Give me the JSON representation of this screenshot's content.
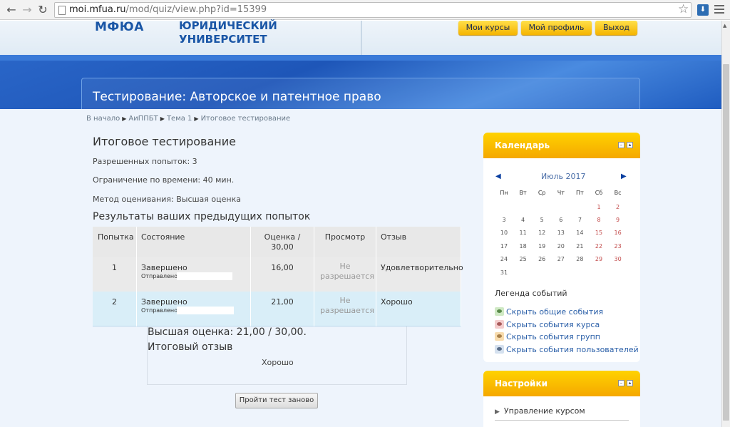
{
  "browser": {
    "url_domain": "moi.mfua.ru",
    "url_path": "/mod/quiz/view.php?id=15399"
  },
  "header": {
    "logo": "МФЮА",
    "university_line1": "ЮРИДИЧЕСКИЙ",
    "university_line2": "УНИВЕРСИТЕТ",
    "buttons": [
      "Мои курсы",
      "Мой профиль",
      "Выход"
    ]
  },
  "page_title": "Тестирование: Авторское и патентное право",
  "breadcrumb": [
    "В начало",
    "АиППБТ",
    "Тема 1",
    "Итоговое тестирование"
  ],
  "quiz": {
    "title": "Итоговое тестирование",
    "attempts_allowed": "Разрешенных попыток: 3",
    "time_limit": "Ограничение по времени: 40 мин.",
    "grading_method": "Метод оценивания: Высшая оценка",
    "results_title": "Результаты ваших предыдущих попыток",
    "columns": [
      "Попытка",
      "Состояние",
      "Оценка / 30,00",
      "Просмотр",
      "Отзыв"
    ],
    "rows": [
      {
        "attempt": "1",
        "state": "Завершено",
        "sent": "Отправлено",
        "grade": "16,00",
        "review": "Не разрешается",
        "feedback": "Удовлетворительно"
      },
      {
        "attempt": "2",
        "state": "Завершено",
        "sent": "Отправлено",
        "grade": "21,00",
        "review": "Не разрешается",
        "feedback": "Хорошо"
      }
    ],
    "highest_grade": "Высшая оценка: 21,00 / 30,00.",
    "final_feedback_label": "Итоговый отзыв",
    "final_feedback": "Хорошо",
    "retry_button": "Пройти тест заново"
  },
  "calendar": {
    "title": "Календарь",
    "month": "Июль 2017",
    "weekdays": [
      "Пн",
      "Вт",
      "Ср",
      "Чт",
      "Пт",
      "Сб",
      "Вс"
    ],
    "weeks": [
      [
        "",
        "",
        "",
        "",
        "",
        "1",
        "2"
      ],
      [
        "3",
        "4",
        "5",
        "6",
        "7",
        "8",
        "9"
      ],
      [
        "10",
        "11",
        "12",
        "13",
        "14",
        "15",
        "16"
      ],
      [
        "17",
        "18",
        "19",
        "20",
        "21",
        "22",
        "23"
      ],
      [
        "24",
        "25",
        "26",
        "27",
        "28",
        "29",
        "30"
      ],
      [
        "31",
        "",
        "",
        "",
        "",
        "",
        ""
      ]
    ],
    "legend_title": "Легенда событий",
    "legend": [
      {
        "label": "Скрыть общие события",
        "color": "#cfe9c4"
      },
      {
        "label": "Скрыть события курса",
        "color": "#f4cdcd"
      },
      {
        "label": "Скрыть события групп",
        "color": "#f8dcae"
      },
      {
        "label": "Скрыть события пользователей",
        "color": "#d5e1ef"
      }
    ]
  },
  "settings": {
    "title": "Настройки",
    "item": "Управление курсом"
  }
}
